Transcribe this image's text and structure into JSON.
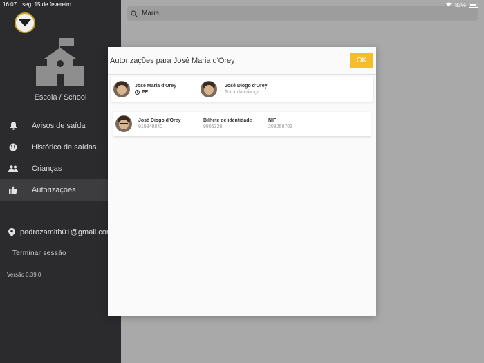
{
  "status_bar": {
    "time": "16:07",
    "date": "seg. 15 de fevereiro",
    "battery": "83%"
  },
  "sidebar": {
    "school_name": "Escola / School",
    "items": [
      {
        "label": "Avisos de saída",
        "icon": "bell-icon"
      },
      {
        "label": "Histórico de saídas",
        "icon": "globe-icon"
      },
      {
        "label": "Crianças",
        "icon": "people-icon"
      },
      {
        "label": "Autorizações",
        "icon": "thumbs-up-icon",
        "active": true
      }
    ],
    "account_email": "pedrozamith01@gmail.com",
    "logout_label": "Terminar sessão",
    "version": "Versão 0.39.0"
  },
  "search": {
    "value": "Maria"
  },
  "modal": {
    "title": "Autorizações para José Maria d'Orey",
    "ok_label": "OK",
    "child": {
      "name": "José Maria d'Orey",
      "badge": "PE"
    },
    "guardian": {
      "name": "José Diogo d'Orey",
      "role": "Tutor da criança"
    },
    "authorized_person": {
      "name": "José Diogo d'Orey",
      "phone": "919848840",
      "id_label": "Bilhete de identidade",
      "id_value": "9805328",
      "nif_label": "NIF",
      "nif_value": "203258703"
    }
  },
  "colors": {
    "sidebar_bg": "#2b2b2e",
    "accent": "#f7bc2a",
    "overlay": "#a9a9a9"
  }
}
